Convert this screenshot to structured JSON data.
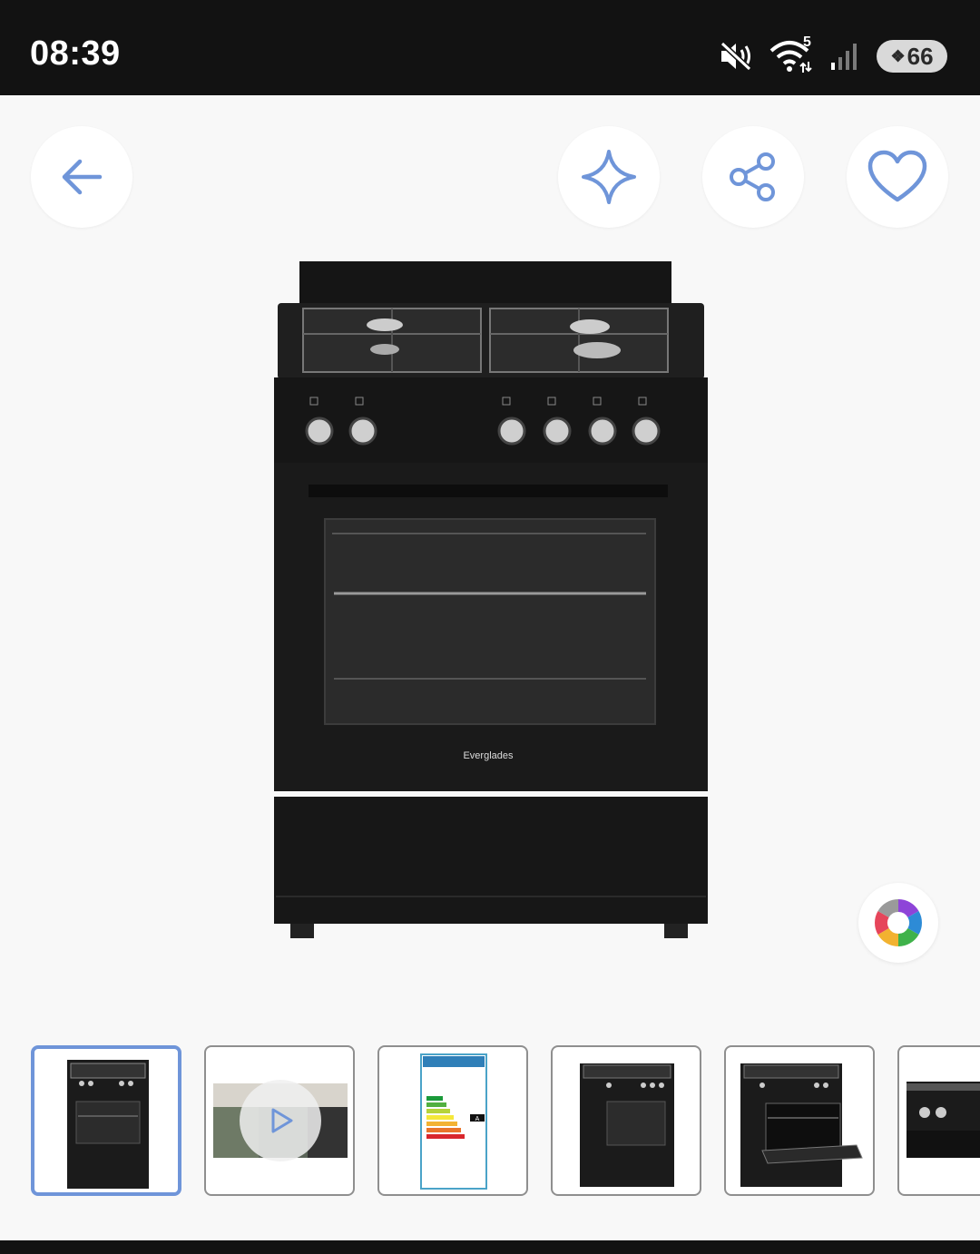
{
  "status_bar": {
    "time": "08:39",
    "network_badge": "5",
    "battery_level": "66",
    "icons": [
      "mute-icon",
      "wifi-icon",
      "signal-icon",
      "battery-saver-icon"
    ]
  },
  "header": {
    "buttons": [
      {
        "name": "back-button",
        "icon": "arrow-left-icon"
      },
      {
        "name": "ai-sparkle-button",
        "icon": "sparkle-icon"
      },
      {
        "name": "share-button",
        "icon": "share-icon"
      },
      {
        "name": "favorite-button",
        "icon": "heart-icon"
      }
    ]
  },
  "product": {
    "brand_logo_text": "Everglades"
  },
  "colors": {
    "accent": "#6f95d9",
    "status_bar_bg": "#121212",
    "page_bg": "#f8f8f8"
  },
  "gallery": {
    "selected_index": 0,
    "thumbnails": [
      {
        "kind": "image",
        "label": "front view"
      },
      {
        "kind": "video",
        "label": "video"
      },
      {
        "kind": "image",
        "label": "energy label",
        "energy_rating": "A"
      },
      {
        "kind": "image",
        "label": "angle view"
      },
      {
        "kind": "image",
        "label": "open door view"
      },
      {
        "kind": "image",
        "label": "control panel close-up"
      }
    ]
  }
}
